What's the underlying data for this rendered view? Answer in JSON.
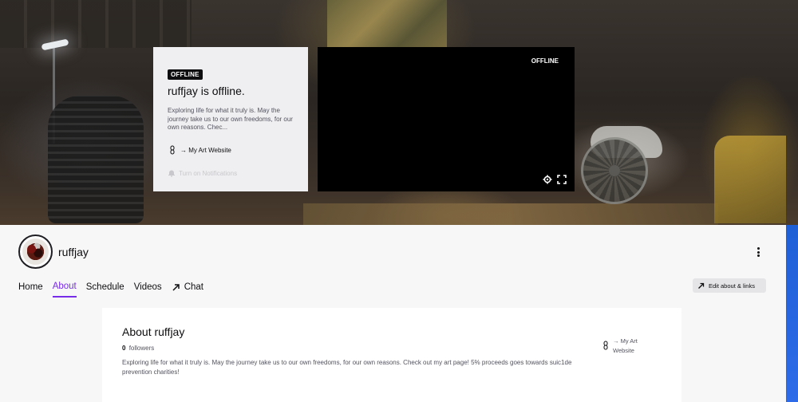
{
  "offline_card": {
    "badge": "OFFLINE",
    "title": "ruffjay is offline.",
    "description": "Exploring life for what it truly is. May the journey take us to our own freedoms, for our own reasons. Chec...",
    "link_label": "→ My Art Website",
    "notify_label": "Turn on Notifications"
  },
  "player": {
    "status": "OFFLINE",
    "settings_icon": "gear-icon",
    "fullscreen_icon": "fullscreen-icon"
  },
  "channel": {
    "name": "ruffjay",
    "more_icon": "more-vertical-icon"
  },
  "tabs": [
    {
      "label": "Home",
      "active": false
    },
    {
      "label": "About",
      "active": true
    },
    {
      "label": "Schedule",
      "active": false
    },
    {
      "label": "Videos",
      "active": false
    },
    {
      "label": "Chat",
      "active": false,
      "icon": "external-arrow-icon"
    }
  ],
  "edit_button": {
    "label": "Edit about & links",
    "icon": "external-arrow-icon"
  },
  "about": {
    "title": "About ruffjay",
    "followers_count": "0",
    "followers_label": "followers",
    "description": "Exploring life for what it truly is. May the journey take us to our own freedoms, for our own reasons. Check out my art page! 5% proceeds goes towards suic1de prevention charities!",
    "link_label": "→ My Art Website"
  },
  "colors": {
    "accent": "#772ce8",
    "text": "#0e0e10",
    "muted": "#53535f",
    "side_strip": "#2d6be8"
  }
}
